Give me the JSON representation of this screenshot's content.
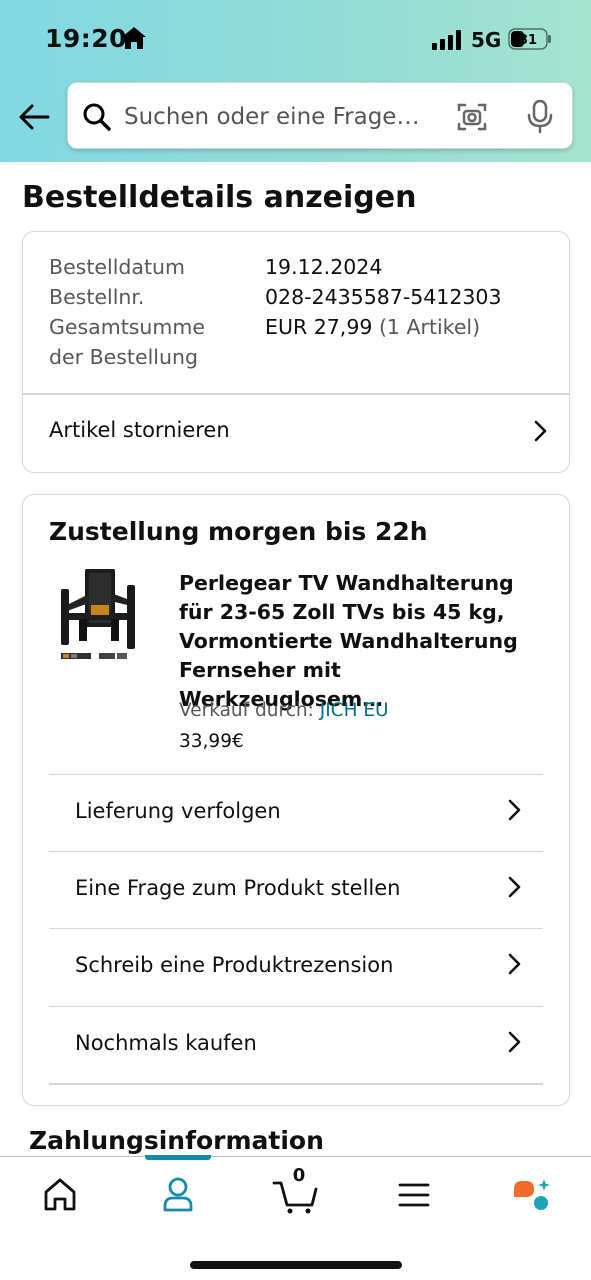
{
  "status_bar": {
    "time": "19:20",
    "network": "5G",
    "battery": "31"
  },
  "search": {
    "placeholder": "Suchen oder eine Frage…"
  },
  "page_title": "Bestelldetails anzeigen",
  "order_info": {
    "rows": [
      {
        "label": "Bestelldatum",
        "value": "19.12.2024"
      },
      {
        "label": "Bestellnr.",
        "value": "028-2435587-5412303"
      },
      {
        "label": "Gesamtsumme",
        "label2": "der Bestellung",
        "value": "EUR 27,99",
        "value_suffix": "(1 Artikel)"
      }
    ],
    "cancel_label": "Artikel stornieren"
  },
  "delivery": {
    "title": "Zustellung morgen bis 22h",
    "product": {
      "title": "Perlegear TV Wandhalterung für 23-65 Zoll TVs bis 45 kg, Vormontierte Wandhalterung Fernseher mit Werkzeuglosem…",
      "seller_prefix": "Verkauf durch:",
      "seller": "JICH EU",
      "price": "33,99€"
    },
    "actions": [
      {
        "label": "Lieferung verfolgen"
      },
      {
        "label": "Eine Frage zum Produkt stellen"
      },
      {
        "label": "Schreib eine Produktrezension"
      },
      {
        "label": "Nochmals kaufen"
      }
    ]
  },
  "payment_title": "Zahlungsinformation",
  "bottom_nav": {
    "active": "account",
    "cart_count": "0",
    "items": [
      "home-icon",
      "account-icon",
      "cart-icon",
      "menu-icon",
      "rufus-icon"
    ]
  },
  "colors": {
    "accent": "#168aad",
    "link": "#007185",
    "rufus_orange": "#f26b2a",
    "rufus_teal": "#1fa3b8"
  }
}
